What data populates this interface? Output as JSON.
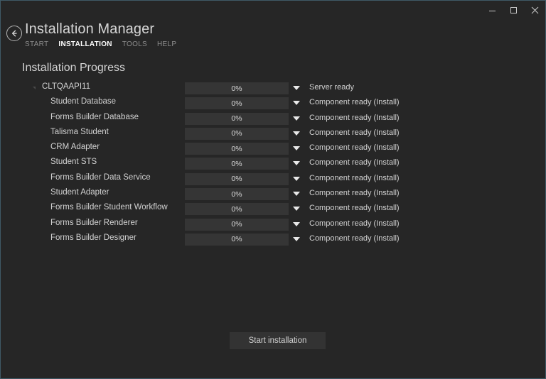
{
  "window": {
    "controls": [
      {
        "name": "minimize",
        "glyph": "minimize-icon"
      },
      {
        "name": "maximize",
        "glyph": "maximize-icon"
      },
      {
        "name": "close",
        "glyph": "close-icon"
      }
    ]
  },
  "header": {
    "back_icon": "back-arrow-icon",
    "title": "Installation Manager",
    "tabs": [
      {
        "label": "START",
        "active": false
      },
      {
        "label": "INSTALLATION",
        "active": true
      },
      {
        "label": "TOOLS",
        "active": false
      },
      {
        "label": "HELP",
        "active": false
      }
    ]
  },
  "main": {
    "section_title": "Installation Progress",
    "rows": [
      {
        "label": "CLTQAAPI11",
        "level": 0,
        "progress_text": "0%",
        "progress_value": 0,
        "status": "Server ready"
      },
      {
        "label": "Student Database",
        "level": 1,
        "progress_text": "0%",
        "progress_value": 0,
        "status": "Component ready (Install)"
      },
      {
        "label": "Forms Builder Database",
        "level": 1,
        "progress_text": "0%",
        "progress_value": 0,
        "status": "Component ready (Install)"
      },
      {
        "label": "Talisma Student",
        "level": 1,
        "progress_text": "0%",
        "progress_value": 0,
        "status": "Component ready (Install)"
      },
      {
        "label": "CRM Adapter",
        "level": 1,
        "progress_text": "0%",
        "progress_value": 0,
        "status": "Component ready (Install)"
      },
      {
        "label": "Student STS",
        "level": 1,
        "progress_text": "0%",
        "progress_value": 0,
        "status": "Component ready (Install)"
      },
      {
        "label": "Forms Builder Data Service",
        "level": 1,
        "progress_text": "0%",
        "progress_value": 0,
        "status": "Component ready (Install)"
      },
      {
        "label": "Student Adapter",
        "level": 1,
        "progress_text": "0%",
        "progress_value": 0,
        "status": "Component ready (Install)"
      },
      {
        "label": "Forms Builder Student Workflow",
        "level": 1,
        "progress_text": "0%",
        "progress_value": 0,
        "status": "Component ready (Install)"
      },
      {
        "label": "Forms Builder Renderer",
        "level": 1,
        "progress_text": "0%",
        "progress_value": 0,
        "status": "Component ready (Install)"
      },
      {
        "label": "Forms Builder Designer",
        "level": 1,
        "progress_text": "0%",
        "progress_value": 0,
        "status": "Component ready (Install)"
      }
    ]
  },
  "footer": {
    "start_label": "Start installation"
  },
  "colors": {
    "window_background": "#262626",
    "window_border": "#3f5a66",
    "progress_track": "#353535",
    "progress_fill": "#2d6ca8",
    "text_primary": "#d2d2d2",
    "text_muted": "#8d8d8d",
    "text_active": "#ffffff",
    "button_background": "#333333"
  }
}
